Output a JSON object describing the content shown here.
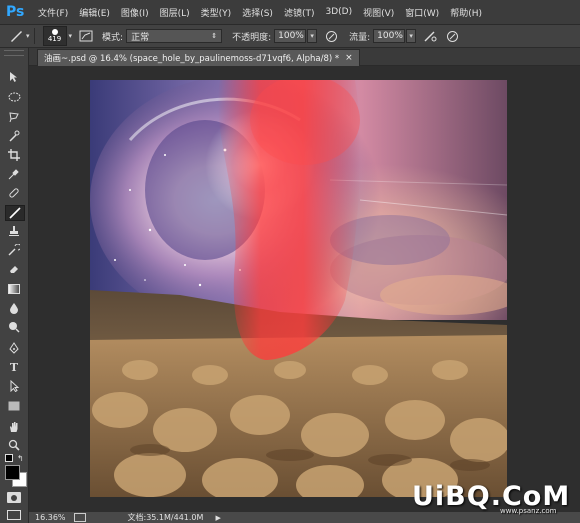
{
  "app": {
    "logo": "Ps",
    "menu": [
      "文件(F)",
      "编辑(E)",
      "图像(I)",
      "图层(L)",
      "类型(Y)",
      "选择(S)",
      "滤镜(T)",
      "3D(D)",
      "视图(V)",
      "窗口(W)",
      "帮助(H)"
    ]
  },
  "options": {
    "brush_size": "419",
    "mode_label": "模式:",
    "mode_value": "正常",
    "opacity_label": "不透明度:",
    "opacity_value": "100%",
    "flow_label": "流量:",
    "flow_value": "100%"
  },
  "document": {
    "tab_title": "油画~.psd @ 16.4% (space_hole_by_paulinemoss-d71vqf6, Alpha/8) *"
  },
  "status": {
    "zoom": "16.36%",
    "doc_size": "文档:35.1M/441.0M"
  },
  "watermark": {
    "text": "UiBQ.CoM",
    "subtext": "www.psanz.com"
  },
  "colors": {
    "accent": "#31a8ff",
    "foreground": "#000000",
    "background": "#ffffff"
  },
  "tools": [
    "move-tool",
    "marquee-tool",
    "lasso-tool",
    "quick-select-tool",
    "crop-tool",
    "eyedropper-tool",
    "healing-tool",
    "brush-tool",
    "clone-stamp-tool",
    "history-brush-tool",
    "eraser-tool",
    "gradient-tool",
    "blur-tool",
    "dodge-tool",
    "pen-tool",
    "type-tool",
    "path-select-tool",
    "shape-tool",
    "hand-tool",
    "zoom-tool"
  ]
}
